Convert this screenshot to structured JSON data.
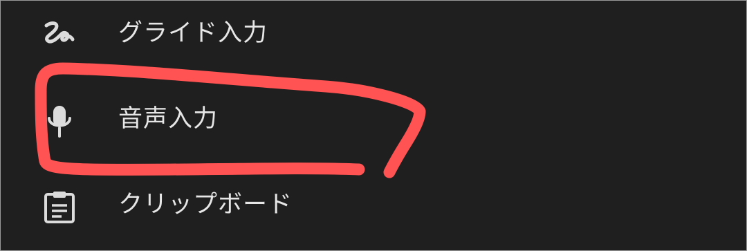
{
  "menu": {
    "items": [
      {
        "label": "グライド入力",
        "icon": "glide-typing-icon"
      },
      {
        "label": "音声入力",
        "icon": "microphone-icon"
      },
      {
        "label": "クリップボード",
        "icon": "clipboard-icon"
      }
    ]
  },
  "annotation": {
    "color": "#ff5252",
    "marks": "voice-input-item"
  }
}
